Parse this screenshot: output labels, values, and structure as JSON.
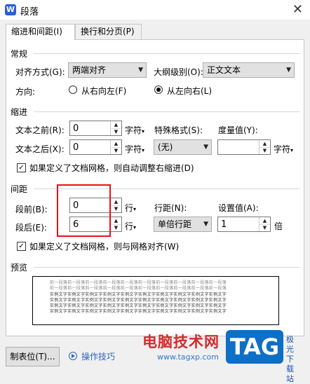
{
  "window": {
    "icon_letter": "W",
    "title": "段落",
    "close": "✕"
  },
  "tabs": [
    {
      "label": "缩进和间距(I)"
    },
    {
      "label": "换行和分页(P)"
    }
  ],
  "general": {
    "heading": "常规",
    "alignment_label": "对齐方式(G):",
    "alignment_value": "两端对齐",
    "outline_label": "大纲级别(O):",
    "outline_value": "正文文本",
    "direction_label": "方向:",
    "rtl_label": "从右向左(F)",
    "ltr_label": "从左向右(L)"
  },
  "indent": {
    "heading": "缩进",
    "before_label": "文本之前(R):",
    "before_value": "0",
    "before_unit": "字符",
    "after_label": "文本之后(X):",
    "after_value": "0",
    "after_unit": "字符",
    "special_label": "特殊格式(S):",
    "special_value": "(无)",
    "measure_label": "度量值(Y):",
    "measure_value": "",
    "measure_unit": "字符",
    "grid_check_label": "如果定义了文档网格，则自动调整右缩进(D)"
  },
  "spacing": {
    "heading": "间距",
    "before_label": "段前(B):",
    "before_value": "0",
    "before_unit": "行",
    "after_label": "段后(E):",
    "after_value": "6",
    "after_unit": "行",
    "line_label": "行距(N):",
    "line_value": "单倍行距",
    "setting_label": "设置值(A):",
    "setting_value": "1",
    "setting_unit": "倍",
    "grid_check_label": "如果定义了文档网格，则与网格对齐(W)"
  },
  "preview": {
    "heading": "预览",
    "prev_line": "前一段落前一段落前一段落前一段落前一段落前一段落前一段落前一段落前一段落前一段落",
    "sample_line": "实例文字实例文字实例文字实例文字实例文字实例文字实例文字实例文字实例文字实例文字"
  },
  "footer": {
    "tabs_button": "制表位(T)...",
    "tips_link": "操作技巧"
  },
  "watermark": {
    "site_text": "电脑技术网",
    "url": "www.tagxp.com",
    "tag": "TAG",
    "side": "极光下载站"
  },
  "colors": {
    "highlight": "#e8101a",
    "link": "#2b63c6",
    "brand": "#0d6fc6"
  }
}
